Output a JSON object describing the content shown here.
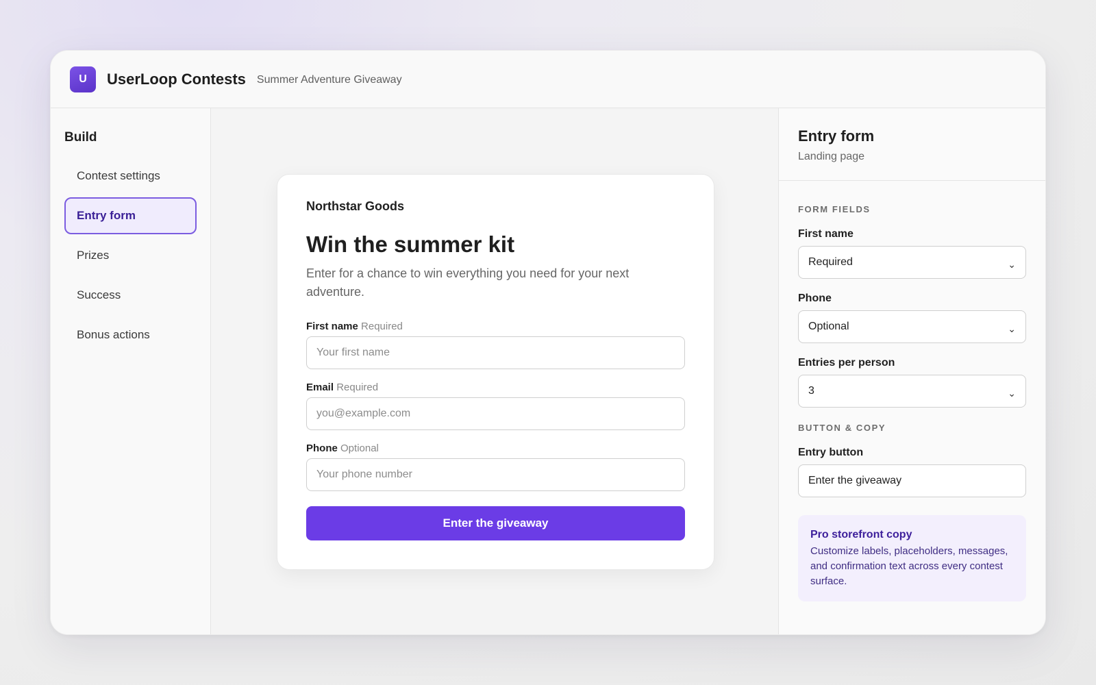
{
  "app": {
    "logo_letter": "U",
    "title": "UserLoop Contests",
    "subtitle": "Summer Adventure Giveaway"
  },
  "sidebar": {
    "heading": "Build",
    "items": [
      {
        "label": "Contest settings",
        "active": false
      },
      {
        "label": "Entry form",
        "active": true
      },
      {
        "label": "Prizes",
        "active": false
      },
      {
        "label": "Success",
        "active": false
      },
      {
        "label": "Bonus actions",
        "active": false
      }
    ]
  },
  "preview": {
    "brand": "Northstar Goods",
    "headline": "Win the summer kit",
    "subcopy": "Enter for a chance to win everything you need for your next adventure.",
    "fields": [
      {
        "label": "First name",
        "hint": "Required",
        "placeholder": "Your first name"
      },
      {
        "label": "Email",
        "hint": "Required",
        "placeholder": "you@example.com"
      },
      {
        "label": "Phone",
        "hint": "Optional",
        "placeholder": "Your phone number"
      }
    ],
    "button_label": "Enter the giveaway",
    "accent_color": "#6b3ce6"
  },
  "panel": {
    "title": "Entry form",
    "subtitle": "Landing page",
    "form_fields_heading": "FORM FIELDS",
    "first_name_label": "First name",
    "first_name_value": "Required",
    "phone_label": "Phone",
    "phone_value": "Optional",
    "entries_label": "Entries per person",
    "entries_value": "3",
    "button_copy_heading": "BUTTON & COPY",
    "entry_button_label": "Entry button",
    "entry_button_value": "Enter the giveaway",
    "promo_title": "Pro storefront copy",
    "promo_text": "Customize labels, placeholders, messages, and confirmation text across every contest surface."
  }
}
